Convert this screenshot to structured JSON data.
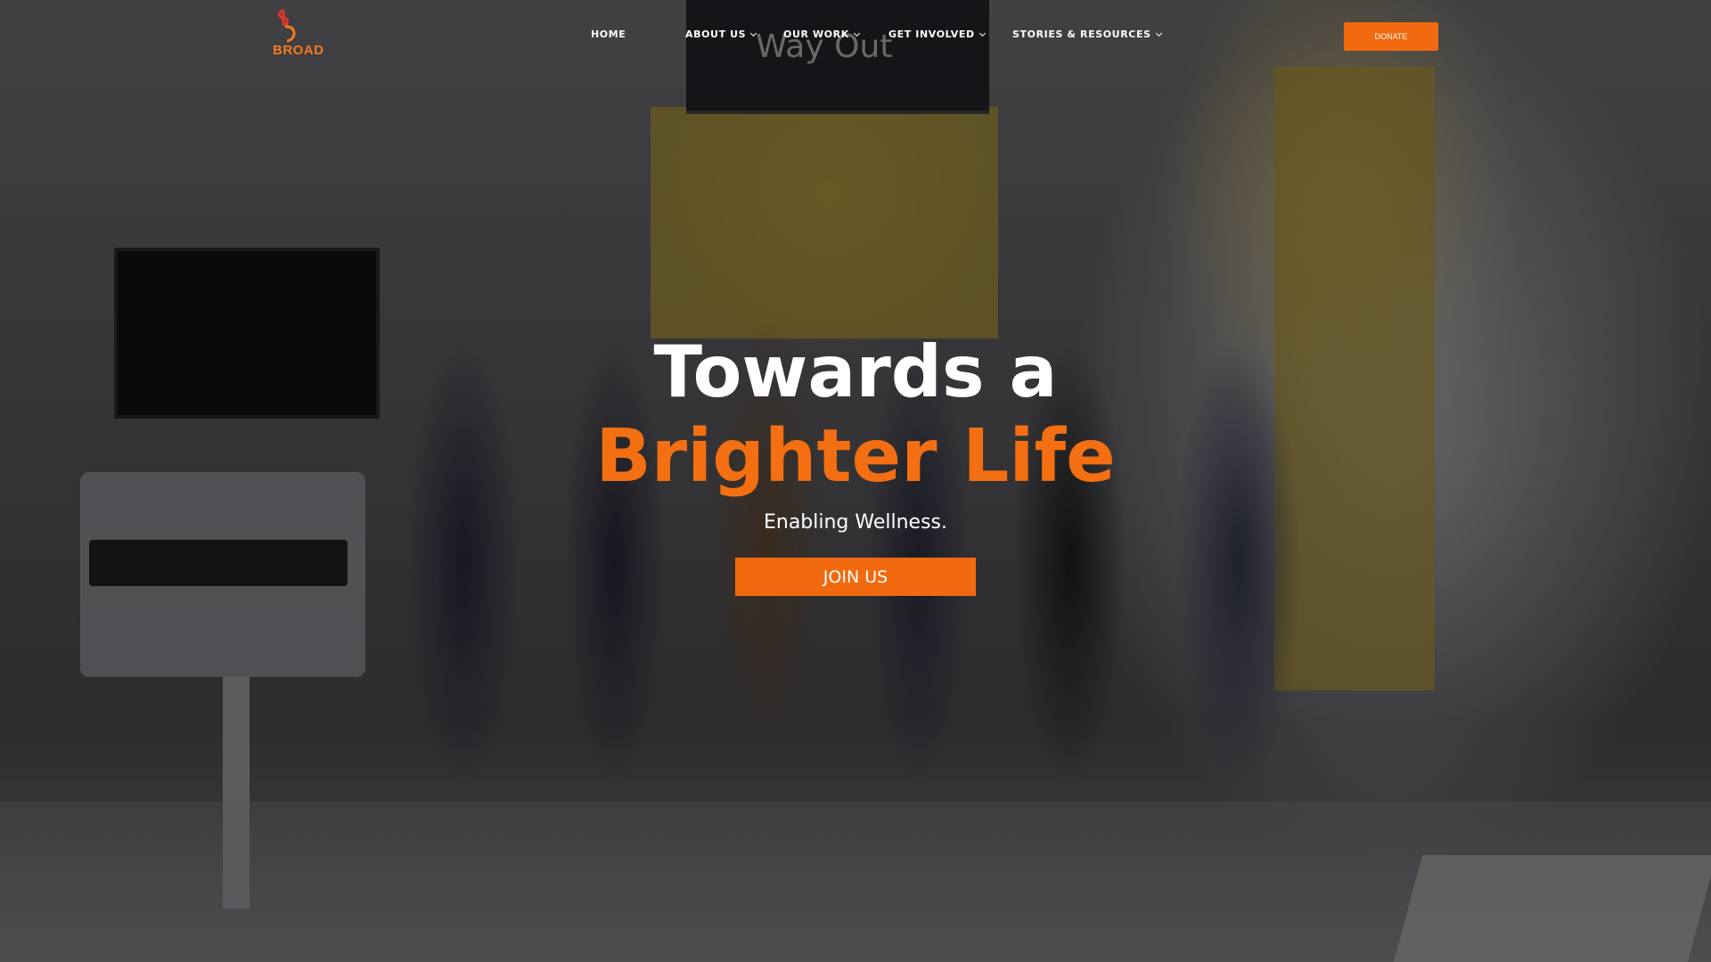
{
  "brand": {
    "logo_text": "BROAD",
    "accent_color": "#f26a0f"
  },
  "nav": {
    "items": [
      {
        "label": "HOME",
        "has_dropdown": false
      },
      {
        "label": "ABOUT US",
        "has_dropdown": true
      },
      {
        "label": "OUR WORK",
        "has_dropdown": true
      },
      {
        "label": "GET INVOLVED",
        "has_dropdown": true
      },
      {
        "label": "STORIES & RESOURCES",
        "has_dropdown": true
      }
    ],
    "donate_label": "DONATE"
  },
  "hero": {
    "title_line1": "Towards a",
    "title_line2": "Brighter Life",
    "subtitle": "Enabling Wellness.",
    "cta_label": "JOIN US",
    "background_sign_text": "Way Out"
  }
}
